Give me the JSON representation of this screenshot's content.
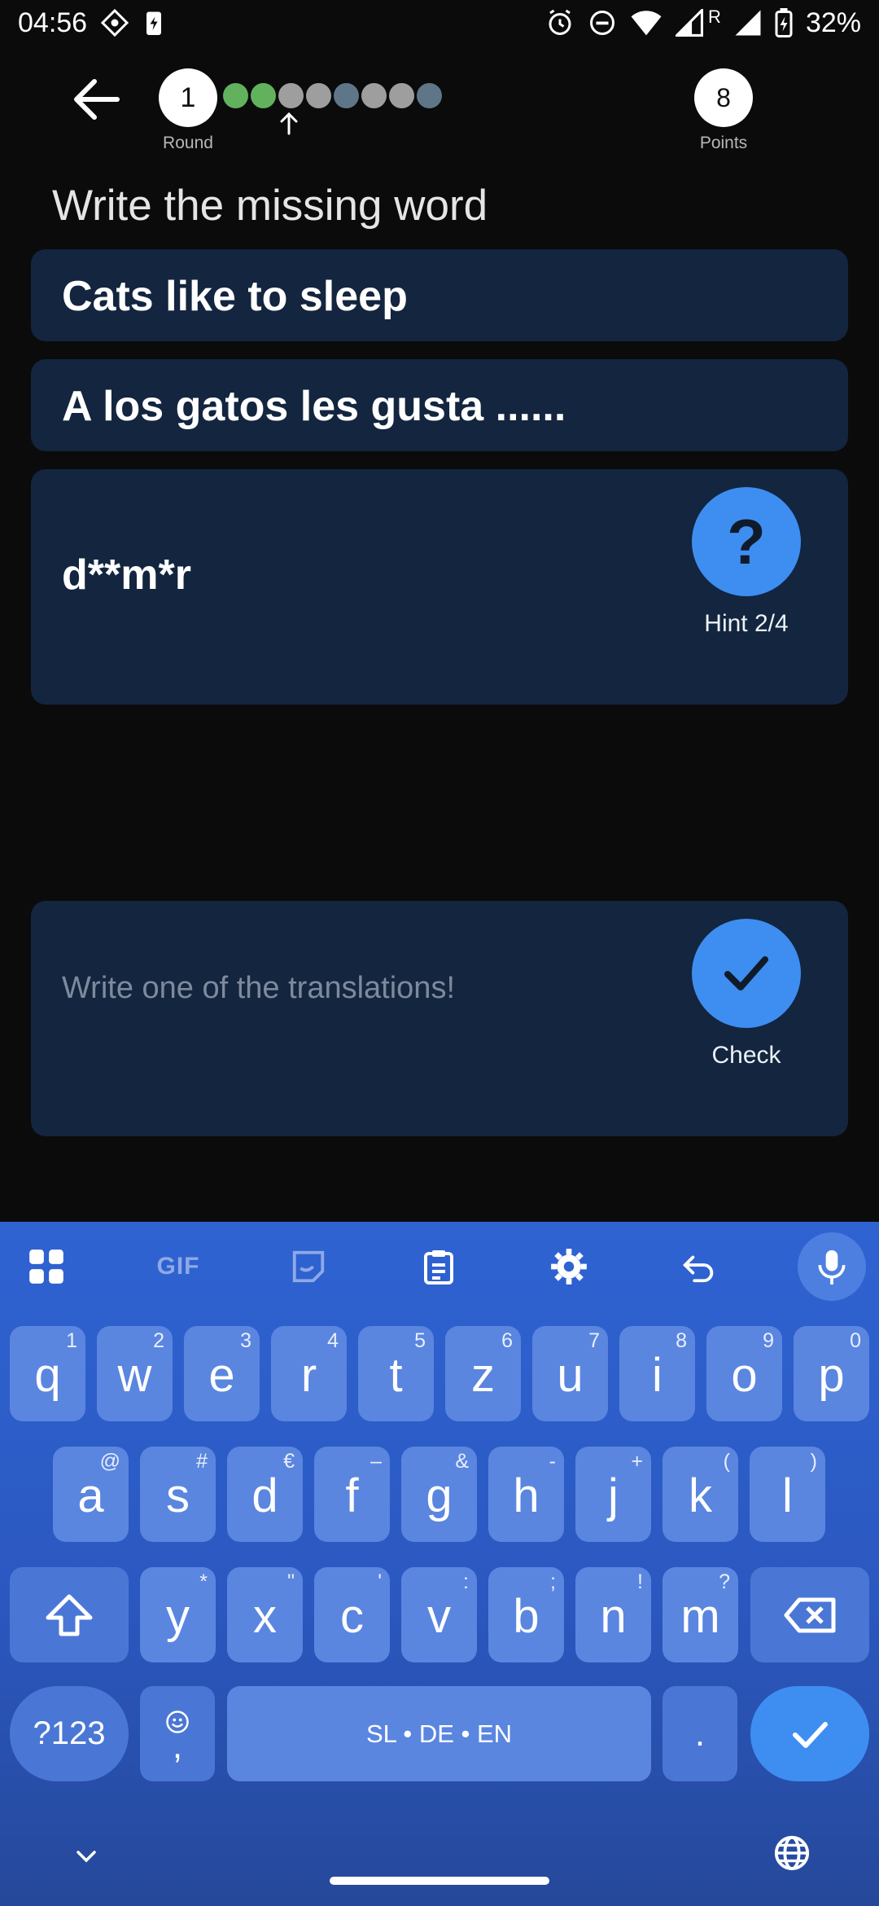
{
  "status_bar": {
    "time": "04:56",
    "battery": "32%",
    "roaming": "R"
  },
  "header": {
    "round_value": "1",
    "round_label": "Round",
    "points_value": "8",
    "points_label": "Points",
    "progress_dots": [
      "green",
      "green",
      "gray",
      "gray",
      "slate",
      "gray",
      "gray",
      "slate"
    ]
  },
  "exercise": {
    "instruction": "Write the missing word",
    "source_sentence": "Cats like to sleep",
    "target_sentence": "A los gatos les gusta ......",
    "hint_text": "d**m*r",
    "hint_label": "Hint 2/4"
  },
  "answer": {
    "placeholder": "Write one of the translations!",
    "value": "",
    "check_label": "Check"
  },
  "keyboard": {
    "row1": [
      [
        "q",
        "1"
      ],
      [
        "w",
        "2"
      ],
      [
        "e",
        "3"
      ],
      [
        "r",
        "4"
      ],
      [
        "t",
        "5"
      ],
      [
        "z",
        "6"
      ],
      [
        "u",
        "7"
      ],
      [
        "i",
        "8"
      ],
      [
        "o",
        "9"
      ],
      [
        "p",
        "0"
      ]
    ],
    "row2": [
      [
        "a",
        "@"
      ],
      [
        "s",
        "#"
      ],
      [
        "d",
        "€"
      ],
      [
        "f",
        "–"
      ],
      [
        "g",
        "&"
      ],
      [
        "h",
        "-"
      ],
      [
        "j",
        "+"
      ],
      [
        "k",
        "("
      ],
      [
        "l",
        ")"
      ]
    ],
    "row3": [
      [
        "y",
        "*"
      ],
      [
        "x",
        "\""
      ],
      [
        "c",
        "'"
      ],
      [
        "v",
        ":"
      ],
      [
        "b",
        ";"
      ],
      [
        "n",
        "!"
      ],
      [
        "m",
        "?"
      ]
    ],
    "symbols_label": "?123",
    "comma_label": ",",
    "space_label": "SL • DE • EN",
    "period_label": ".",
    "gif_label": "GIF"
  },
  "colors": {
    "card": "#13253f",
    "accent": "#3d8ef0",
    "keyboard": "#2f63d2"
  }
}
